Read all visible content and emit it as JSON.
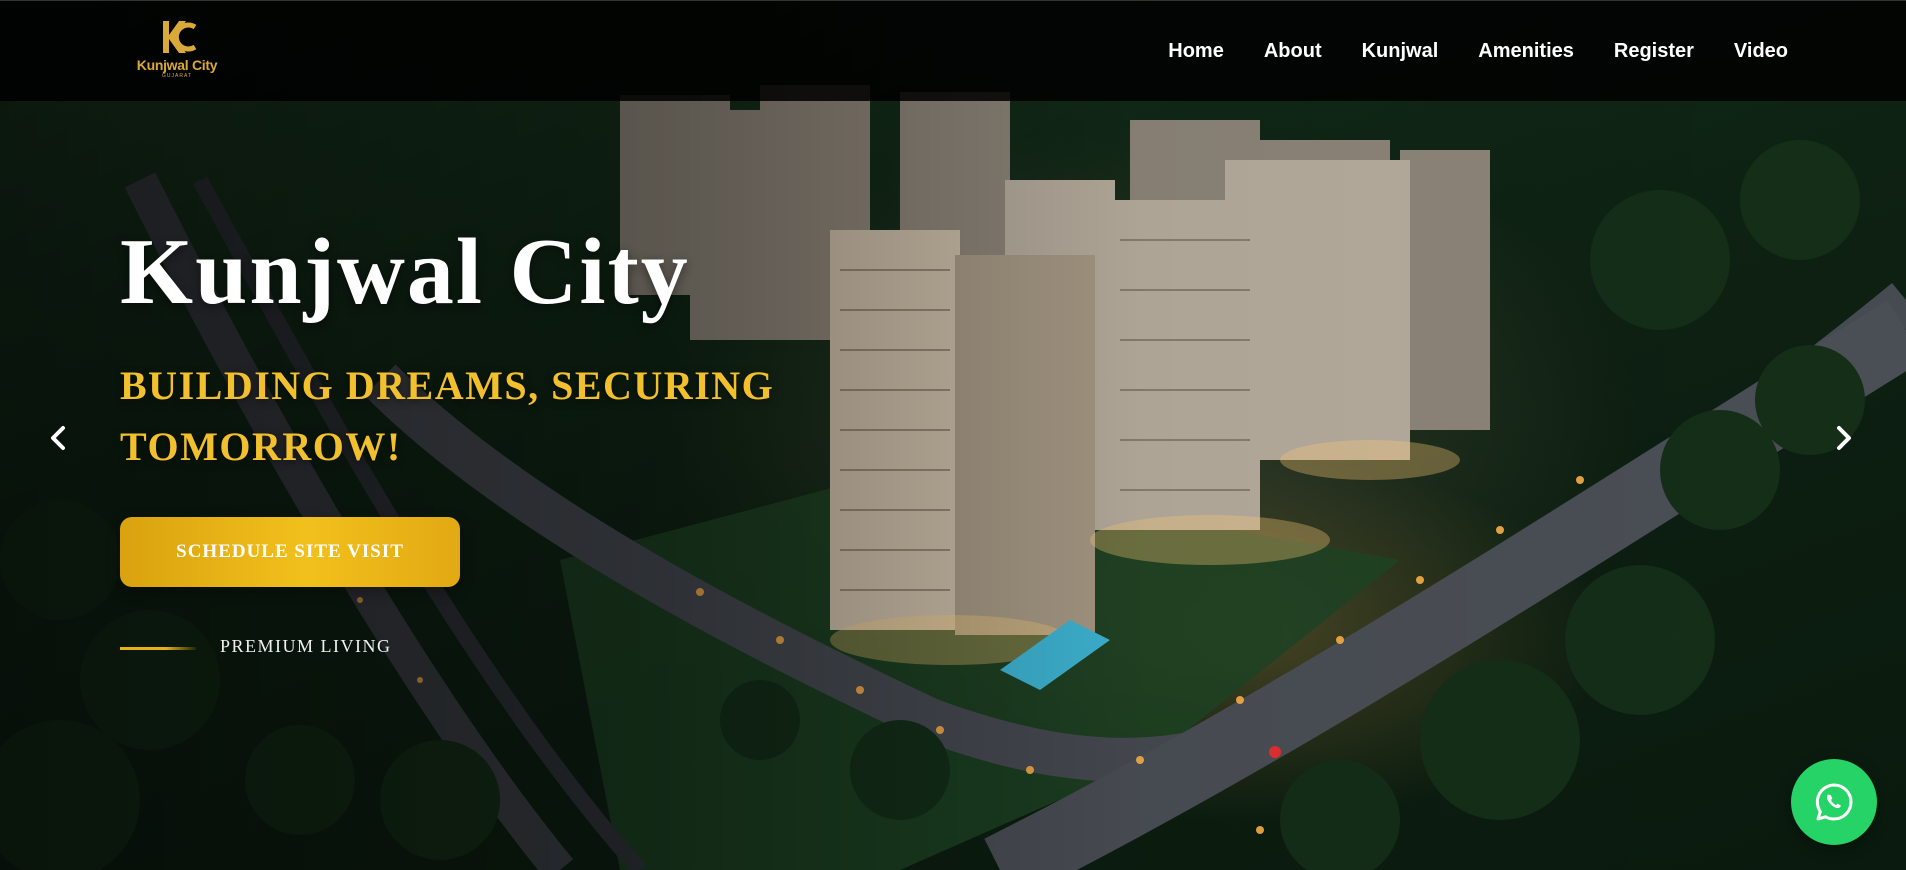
{
  "brand": {
    "logo_name": "Kunjwal City",
    "logo_sub": "GUJARAT",
    "accent_color": "#f1c02c"
  },
  "nav": {
    "items": [
      {
        "label": "Home"
      },
      {
        "label": "About"
      },
      {
        "label": "Kunjwal"
      },
      {
        "label": "Amenities"
      },
      {
        "label": "Register"
      },
      {
        "label": "Video"
      }
    ]
  },
  "hero": {
    "title": "Kunjwal City",
    "subtitle": "BUILDING DREAMS, SECURING TOMORROW!",
    "cta_label": "SCHEDULE SITE VISIT",
    "tagline": "PREMIUM LIVING",
    "background_image": "aerial view of high-rise residential towers at dusk"
  },
  "carousel": {
    "prev_icon": "chevron-left-icon",
    "next_icon": "chevron-right-icon"
  },
  "whatsapp": {
    "icon": "whatsapp-icon",
    "color": "#25d366"
  }
}
